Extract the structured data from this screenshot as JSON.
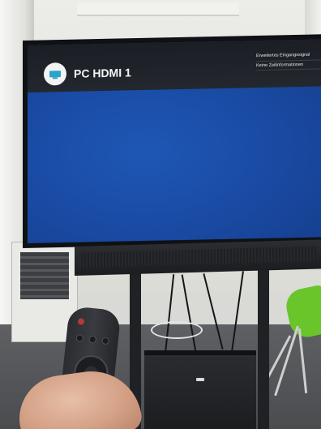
{
  "tv_osd": {
    "source_title": "PC HDMI 1",
    "source_icon": "pc-monitor-icon",
    "menu_items": [
      "Erweitertes Eingangssignal",
      "Keine Zeitinformationen"
    ]
  },
  "colors": {
    "screen_blue": "#1a4ca6",
    "osd_bar": "#1f2228",
    "chair_green": "#69c52a",
    "source_icon_accent": "#2aa5c9"
  }
}
